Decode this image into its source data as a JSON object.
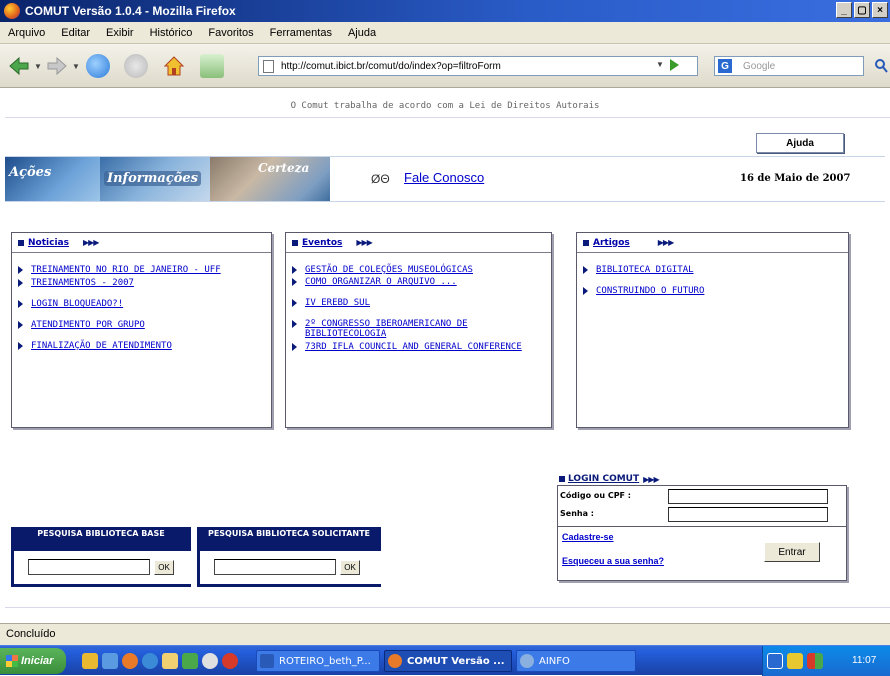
{
  "window": {
    "title": "COMUT Versão 1.0.4 - Mozilla Firefox",
    "buttons": [
      "_",
      "▢",
      "×"
    ]
  },
  "menu": [
    "Arquivo",
    "Editar",
    "Exibir",
    "Histórico",
    "Favoritos",
    "Ferramentas",
    "Ajuda"
  ],
  "navbar": {
    "url": "http://comut.ibict.br/comut/do/index?op=filtroForm",
    "search_placeholder": "Google"
  },
  "page": {
    "copyright": "O Comut trabalha de acordo com a Lei de Direitos Autorais",
    "help_button": "Ajuda",
    "banner": {
      "acoes": "Ações",
      "informacoes": "Informações",
      "certeza": "Certeza"
    },
    "fale_icon": "ØΘ",
    "fale_conosco": "Fale Conosco",
    "date": "16 de Maio de 2007",
    "noticias": {
      "title": "Noticias",
      "arrows": "▶▶▶",
      "items": [
        "TREINAMENTO NO RIO DE JANEIRO - UFF",
        "TREINAMENTOS - 2007",
        "LOGIN BLOQUEADO?!",
        "ATENDIMENTO POR GRUPO",
        "FINALIZAÇÃO DE ATENDIMENTO"
      ]
    },
    "eventos": {
      "title": "Eventos",
      "arrows": "▶▶▶",
      "items": [
        "GESTÃO DE COLEÇÕES MUSEOLÓGICAS",
        "COMO ORGANIZAR O ARQUIVO ...",
        "IV EREBD SUL",
        "2º CONGRESSO IBEROAMERICANO DE BIBLIOTECOLOGIA",
        "73RD IFLA COUNCIL AND GENERAL CONFERENCE"
      ]
    },
    "artigos": {
      "title": "Artigos",
      "arrows": "▶▶▶",
      "items": [
        "BIBLIOTECA DIGITAL",
        "CONSTRUINDO O FUTURO"
      ]
    },
    "login": {
      "title": "LOGIN COMUT",
      "arrows": "▶▶▶",
      "cpf_label": "Código ou CPF :",
      "senha_label": "Senha :",
      "cadastre": "Cadastre-se",
      "esqueceu": "Esqueceu a sua senha?",
      "entrar": "Entrar"
    },
    "pesquisa_base": {
      "title": "PESQUISA BIBLIOTECA BASE",
      "ok": "OK"
    },
    "pesquisa_solicitante": {
      "title": "PESQUISA BIBLIOTECA SOLICITANTE",
      "ok": "OK"
    }
  },
  "status": "Concluído",
  "taskbar": {
    "start": "Iniciar",
    "tasks": [
      "ROTEIRO_beth_P...",
      "COMUT Versão ...",
      "AINFO"
    ],
    "clock": "11:07"
  }
}
